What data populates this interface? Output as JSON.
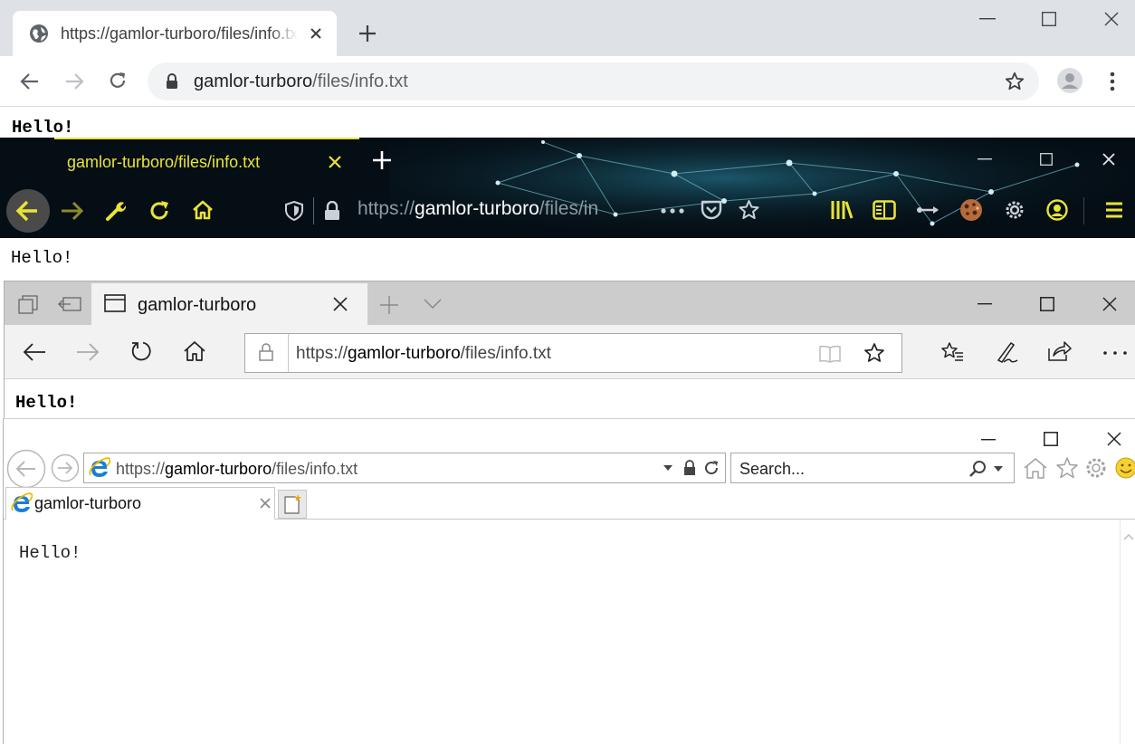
{
  "chrome": {
    "tab_title": "https://gamlor-turboro/files/info.txt",
    "url_host": "gamlor-turboro",
    "url_path": "/files/info.txt",
    "page_text": "Hello!",
    "colors": {
      "tabbar": "#dee1e6",
      "omnibox": "#f1f3f4"
    },
    "icons": [
      "globe-icon",
      "close-icon",
      "plus-icon",
      "back-icon",
      "forward-icon",
      "reload-icon",
      "lock-icon",
      "star-icon",
      "avatar-icon",
      "menu-icon"
    ]
  },
  "firefox": {
    "tab_title": "gamlor-turboro/files/info.txt",
    "url_scheme": "https://",
    "url_host": "gamlor-turboro",
    "url_path": "/files/in",
    "page_text": "Hello!",
    "colors": {
      "background": "#050e15",
      "accent": "#e9e336"
    },
    "icons": [
      "back-icon",
      "forward-icon",
      "wrench-icon",
      "reload-icon",
      "home-icon",
      "shield-icon",
      "lock-icon",
      "more-icon",
      "pocket-icon",
      "star-icon",
      "library-icon",
      "reader-icon",
      "extension-icon",
      "cookie-icon",
      "gear-icon",
      "account-icon",
      "menu-icon"
    ]
  },
  "edge": {
    "tab_title": "gamlor-turboro",
    "url_scheme": "https://",
    "url_host": "gamlor-turboro",
    "url_path": "/files/info.txt",
    "page_text": "Hello!",
    "colors": {
      "tabbar": "#cccccc",
      "toolbar": "#f2f2f2"
    },
    "icons": [
      "tab-preview-icon",
      "set-aside-icon",
      "page-icon",
      "close-icon",
      "plus-icon",
      "chevron-down-icon",
      "back-icon",
      "forward-icon",
      "reload-icon",
      "home-icon",
      "lock-icon",
      "reading-view-icon",
      "star-icon",
      "favorites-icon",
      "pen-icon",
      "share-icon",
      "more-icon"
    ]
  },
  "ie": {
    "url_scheme": "https://",
    "url_host": "gamlor-turboro",
    "url_path": "/files/info.txt",
    "search_placeholder": "Search...",
    "tab_title": "gamlor-turboro",
    "page_text": "Hello!",
    "icons": [
      "back-icon",
      "forward-icon",
      "ie-logo-icon",
      "dropdown-icon",
      "lock-icon",
      "refresh-icon",
      "search-icon",
      "close-icon",
      "new-tab-icon",
      "home-icon",
      "star-icon",
      "gear-icon",
      "smiley-icon"
    ]
  }
}
